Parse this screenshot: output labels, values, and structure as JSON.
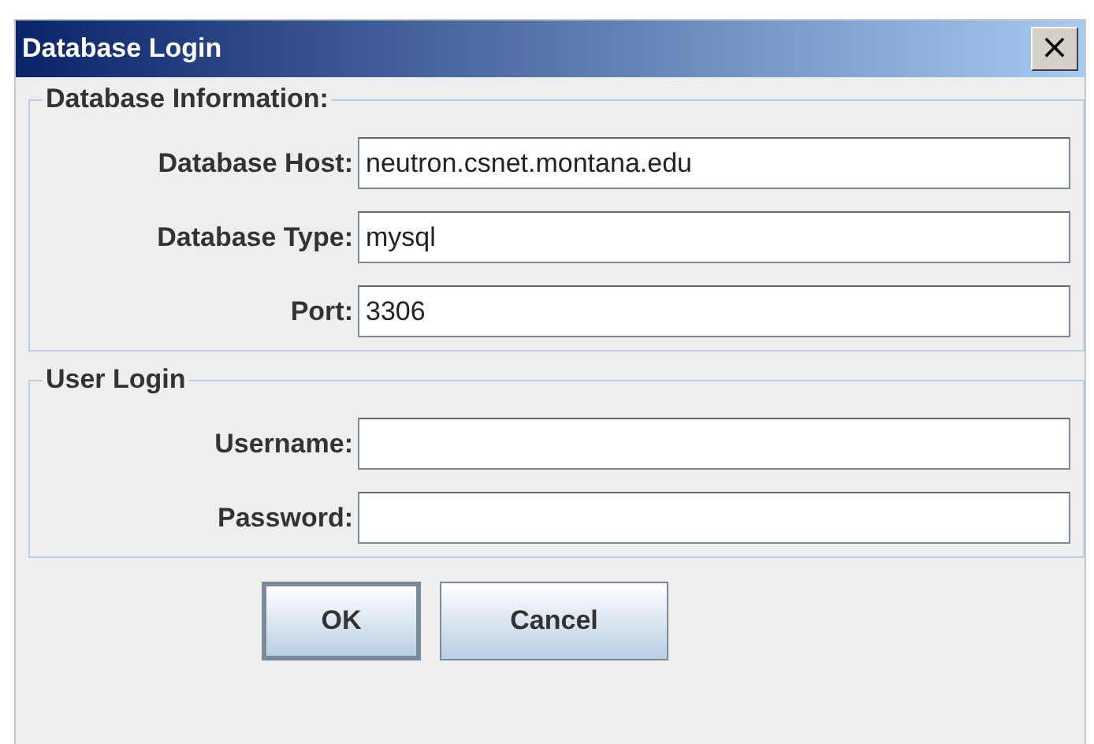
{
  "window": {
    "title": "Database Login",
    "close": "×"
  },
  "sections": [
    {
      "title": "Database Information:",
      "fields": [
        {
          "label": "Database Host:",
          "value": "neutron.csnet.montana.edu"
        },
        {
          "label": "Database Type:",
          "value": "mysql"
        },
        {
          "label": "Port:",
          "value": "3306"
        }
      ]
    },
    {
      "title": "User Login",
      "fields": [
        {
          "label": "Username:"
        },
        {
          "label": "Password:"
        }
      ]
    }
  ],
  "buttons": [
    {
      "label": "OK",
      "default": true
    },
    {
      "label": "Cancel",
      "default": false
    }
  ]
}
